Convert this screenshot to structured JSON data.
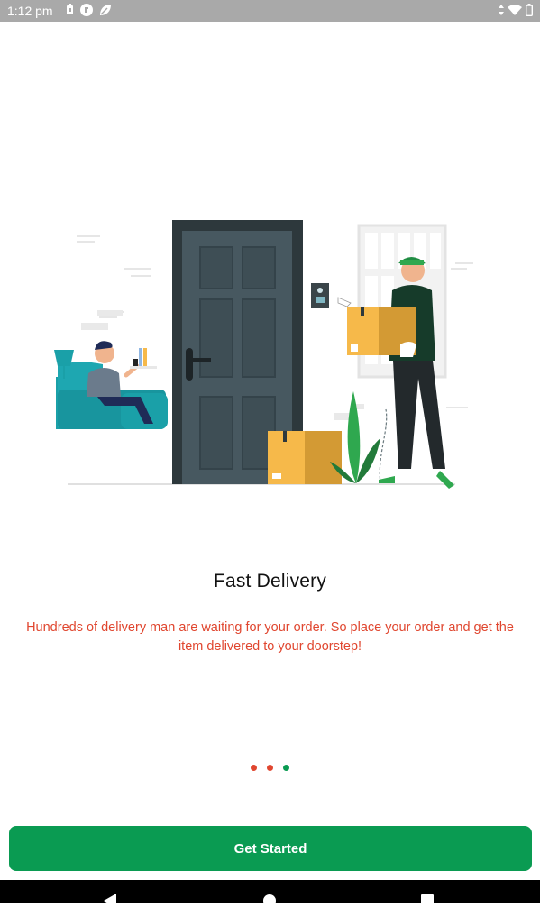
{
  "status_bar": {
    "time": "1:12 pm",
    "icons": [
      "battery-saver-icon",
      "app-notification-icon",
      "leaf-icon"
    ],
    "right_icons": [
      "data-arrows-icon",
      "wifi-icon",
      "battery-icon"
    ]
  },
  "onboarding": {
    "title": "Fast Delivery",
    "description": "Hundreds of delivery man are waiting for your order. So place your order and get the item delivered to your doorstep!",
    "page_indicator": {
      "count": 3,
      "active_index": 2
    },
    "cta_label": "Get Started"
  },
  "colors": {
    "primary_green": "#0a9b52",
    "accent_red": "#e0462f",
    "status_bar": "#a9a9a9"
  },
  "navigation_bar": {
    "buttons": [
      "back-icon",
      "home-icon",
      "recents-icon"
    ]
  }
}
